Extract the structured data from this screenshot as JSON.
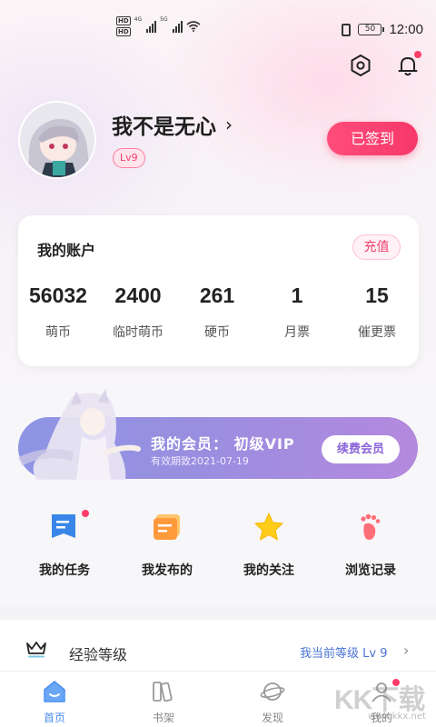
{
  "status_bar": {
    "hd1": "HD",
    "hd2": "HD",
    "net1": "4G",
    "net2": "5G",
    "battery": "50",
    "time": "12:00"
  },
  "header": {
    "settings_icon": "settings-icon",
    "notification_icon": "bell-icon",
    "notification_dot_color": "#ff3d6a"
  },
  "profile": {
    "username": "我不是无心",
    "chevron": "›",
    "level": "Lv9",
    "checkin_label": "已签到"
  },
  "account": {
    "title": "我的账户",
    "recharge_label": "充值",
    "stats": [
      {
        "value": "56032",
        "label": "萌币"
      },
      {
        "value": "2400",
        "label": "临时萌币"
      },
      {
        "value": "261",
        "label": "硬币"
      },
      {
        "value": "1",
        "label": "月票"
      },
      {
        "value": "15",
        "label": "催更票"
      }
    ]
  },
  "vip": {
    "title": "我的会员： 初级VIP",
    "expire": "有效期致2021-07-19",
    "renew_label": "续费会员"
  },
  "actions": [
    {
      "label": "我的任务",
      "icon": "task-icon"
    },
    {
      "label": "我发布的",
      "icon": "publish-icon"
    },
    {
      "label": "我的关注",
      "icon": "star-icon"
    },
    {
      "label": "浏览记录",
      "icon": "footprint-icon"
    }
  ],
  "experience": {
    "label": "经验等级",
    "current": "我当前等级 Lv 9",
    "chevron": "›"
  },
  "tabs": [
    {
      "label": "首页",
      "icon": "home-icon",
      "active": true
    },
    {
      "label": "书架",
      "icon": "bookshelf-icon",
      "active": false
    },
    {
      "label": "发现",
      "icon": "planet-icon",
      "active": false
    },
    {
      "label": "我的",
      "icon": "profile-icon",
      "active": false
    }
  ],
  "watermark": {
    "text": "KK下载",
    "sub": "www.kkx.net"
  },
  "colors": {
    "accent": "#f6386a",
    "vip_gradient_start": "#8d95e4",
    "vip_gradient_end": "#b489de",
    "link_blue": "#4a74d6",
    "tab_active": "#4a8ef0"
  }
}
